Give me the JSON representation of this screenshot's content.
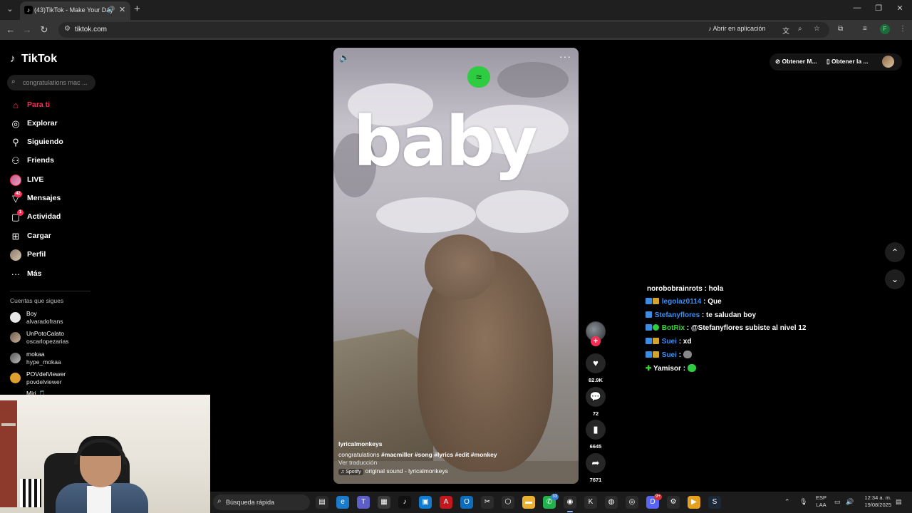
{
  "browser": {
    "tab_title": "(43)TikTok - Make Your Day",
    "url": "tiktok.com",
    "open_in_app": "Abrir en aplicación",
    "profile_initial": "F"
  },
  "sidebar": {
    "logo": "TikTok",
    "search_placeholder": "congratulations mac ...",
    "nav": [
      {
        "label": "Para ti",
        "icon": "home-icon",
        "active": true
      },
      {
        "label": "Explorar",
        "icon": "compass-icon"
      },
      {
        "label": "Siguiendo",
        "icon": "user-follow-icon"
      },
      {
        "label": "Friends",
        "icon": "friends-icon"
      },
      {
        "label": "LIVE",
        "icon": "live-avatar"
      },
      {
        "label": "Mensajes",
        "icon": "message-icon",
        "badge": "42"
      },
      {
        "label": "Actividad",
        "icon": "activity-icon",
        "badge": "1"
      },
      {
        "label": "Cargar",
        "icon": "upload-icon"
      },
      {
        "label": "Perfil",
        "icon": "profile-avatar"
      },
      {
        "label": "Más",
        "icon": "more-icon"
      }
    ],
    "following_title": "Cuentas que sigues",
    "accounts": [
      {
        "name": "Boy",
        "user": "alvaradofrans"
      },
      {
        "name": "UnPotoCalato",
        "user": "oscarlopezarias"
      },
      {
        "name": "mokaa",
        "user": "hype_mokaa"
      },
      {
        "name": "POVdelViewer",
        "user": "povdelviewer"
      },
      {
        "name": "Miri 🎵",
        "user": ""
      }
    ]
  },
  "video": {
    "lyric": "baby",
    "author": "lyricalmonkeys",
    "description": "congratulations",
    "hashtags": [
      "#macmiller",
      "#song",
      "#lyrics",
      "#edit",
      "#monkey"
    ],
    "translate": "Ver traducción",
    "music_chip": "Spotify",
    "music": "original sound - lyricalmonkeys"
  },
  "actions": {
    "likes": "82.9K",
    "comments": "72",
    "saves": "6645",
    "shares": "7671"
  },
  "top_right": {
    "get_mac": "Obtener M...",
    "get_app": "Obtener la ..."
  },
  "chat": [
    {
      "user": "norobobrainrots",
      "msg": ": hola",
      "badges": [],
      "color": "white"
    },
    {
      "user": "legolaz0114",
      "msg": ": Que",
      "badges": [
        "blue",
        "gold"
      ],
      "color": "blue"
    },
    {
      "user": "Stefanyflores",
      "msg": ": te saludan boy",
      "badges": [
        "blue"
      ],
      "color": "blue"
    },
    {
      "user": "BotRix",
      "msg": ": @Stefanyflores subiste al nivel 12",
      "badges": [
        "blue",
        "green"
      ],
      "color": "green"
    },
    {
      "user": "Suei",
      "msg": ": xd",
      "badges": [
        "blue",
        "gold"
      ],
      "color": "blue"
    },
    {
      "user": "Suei",
      "msg": ":",
      "badges": [
        "blue",
        "gold"
      ],
      "color": "blue"
    },
    {
      "user": "Yamisor",
      "msg": ":",
      "badges": [
        "plus"
      ],
      "color": "white"
    }
  ],
  "taskbar": {
    "search_label": "Búsqueda rápida",
    "lang_top": "ESP",
    "lang_bottom": "LAA",
    "time": "12:34 a. m.",
    "date": "19/08/2025",
    "whatsapp_badge": "33",
    "discord_badge": "9+"
  }
}
